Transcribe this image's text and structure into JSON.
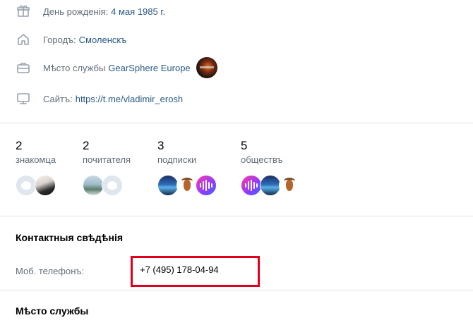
{
  "profile_info": {
    "birthday": {
      "label": "День рожденія:",
      "value": "4 мая 1985 г.",
      "icon": "gift-icon"
    },
    "city": {
      "label": "Городъ:",
      "value": "Смоленскъ",
      "icon": "home-icon"
    },
    "work": {
      "label": "Мѣсто службы",
      "value": "GearSphere Europe",
      "icon": "briefcase-icon"
    },
    "site": {
      "label": "Сайтъ:",
      "value": "https://t.me/vladimir_erosh",
      "icon": "monitor-icon"
    }
  },
  "counters": [
    {
      "count": "2",
      "caption": "знакомца"
    },
    {
      "count": "2",
      "caption": "почитателя"
    },
    {
      "count": "3",
      "caption": "подписки"
    },
    {
      "count": "5",
      "caption": "обществъ"
    }
  ],
  "contacts": {
    "title": "Контактныя свѣдѣнія",
    "phone_label": "Моб. телефонъ:",
    "phone_value": "+7 (495) 178-04-94"
  },
  "work_section": {
    "title": "Мѣсто службы"
  },
  "colors": {
    "link": "#2a5885",
    "label": "#626d7a",
    "divider": "#dce1e6",
    "highlight": "#e0001b"
  }
}
